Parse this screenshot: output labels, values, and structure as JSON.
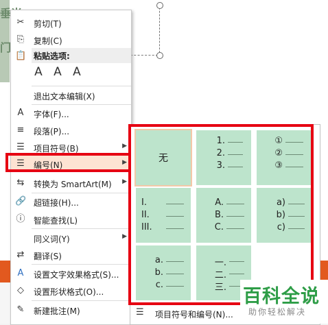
{
  "slide": {
    "text_top": "垂当",
    "text_mid": "门"
  },
  "context_menu": {
    "items": [
      {
        "icon": "scissors-icon",
        "glyph": "✂",
        "label": "剪切(T)"
      },
      {
        "icon": "copy-icon",
        "glyph": "⎘",
        "label": "复制(C)"
      },
      {
        "icon": "paste-icon",
        "glyph": "📋",
        "label": "粘贴选项:"
      },
      {
        "icon": "",
        "glyph": "",
        "label": "退出文本编辑(X)"
      },
      {
        "icon": "font-icon",
        "glyph": "A",
        "label": "字体(F)..."
      },
      {
        "icon": "paragraph-icon",
        "glyph": "≡",
        "label": "段落(P)..."
      },
      {
        "icon": "bullets-icon",
        "glyph": "☰",
        "label": "项目符号(B)"
      },
      {
        "icon": "numbering-icon",
        "glyph": "☰",
        "label": "编号(N)"
      },
      {
        "icon": "smartart-icon",
        "glyph": "⇆",
        "label": "转换为 SmartArt(M)"
      },
      {
        "icon": "hyperlink-icon",
        "glyph": "🔗",
        "label": "超链接(H)..."
      },
      {
        "icon": "smart-lookup-icon",
        "glyph": "ⓘ",
        "label": "智能查找(L)"
      },
      {
        "icon": "",
        "glyph": "",
        "label": "同义词(Y)"
      },
      {
        "icon": "translate-icon",
        "glyph": "⇄",
        "label": "翻译(S)"
      },
      {
        "icon": "text-effects-icon",
        "glyph": "A",
        "label": "设置文字效果格式(S)..."
      },
      {
        "icon": "shape-format-icon",
        "glyph": "◇",
        "label": "设置形状格式(O)..."
      },
      {
        "icon": "new-comment-icon",
        "glyph": "✎",
        "label": "新建批注(M)"
      }
    ],
    "paste_options": [
      "A",
      "A",
      "A"
    ]
  },
  "gallery": {
    "none_label": "无",
    "styles": [
      [
        "1.",
        "2.",
        "3."
      ],
      [
        "①",
        "②",
        "③"
      ],
      [
        "I.",
        "II.",
        "III."
      ],
      [
        "A.",
        "B.",
        "C."
      ],
      [
        "a)",
        "b)",
        "c)"
      ],
      [
        "a.",
        "b.",
        "c."
      ],
      [
        "一.",
        "二.",
        "三."
      ]
    ],
    "footer_label": "项目符号和编号(N)..."
  },
  "watermark": {
    "title": "百科全说",
    "subtitle": "助你轻松解决"
  }
}
